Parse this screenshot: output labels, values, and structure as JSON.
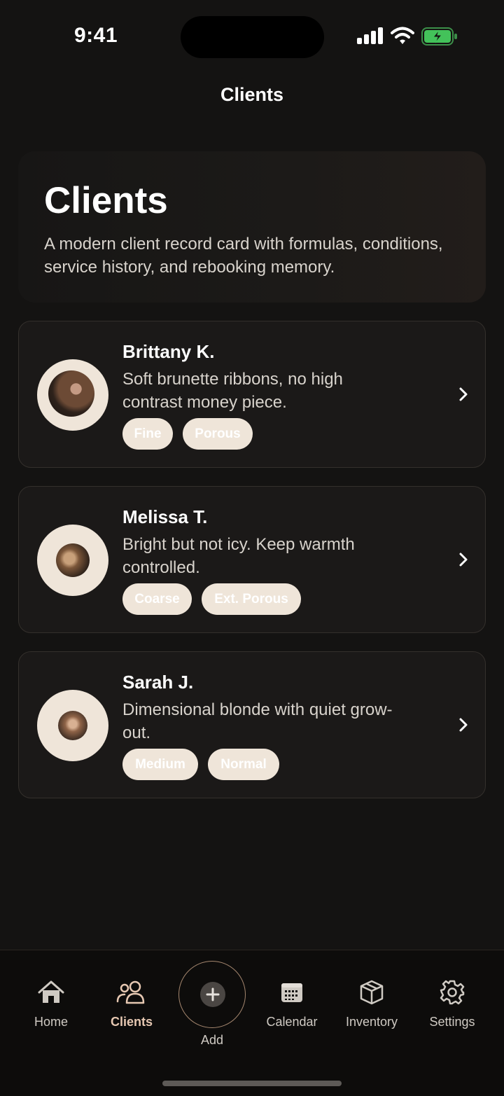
{
  "status_bar": {
    "time": "9:41"
  },
  "nav": {
    "title": "Clients"
  },
  "header": {
    "title": "Clients",
    "subtitle": "A modern client record card with formulas, conditions, service history, and rebooking memory."
  },
  "clients": [
    {
      "name": "Brittany K.",
      "note": "Soft brunette ribbons, no high contrast money piece.",
      "tags": [
        "Fine",
        "Porous"
      ]
    },
    {
      "name": "Melissa T.",
      "note": "Bright but not icy. Keep warmth controlled.",
      "tags": [
        "Coarse",
        "Ext. Porous"
      ]
    },
    {
      "name": "Sarah J.",
      "note": "Dimensional blonde with quiet grow-out.",
      "tags": [
        "Medium",
        "Normal"
      ]
    }
  ],
  "tab_bar": {
    "items": [
      {
        "label": "Home",
        "icon": "home-icon",
        "active": false
      },
      {
        "label": "Clients",
        "icon": "people-icon",
        "active": true
      },
      {
        "label": "Add",
        "icon": "plus-icon",
        "active": false
      },
      {
        "label": "Calendar",
        "icon": "calendar-icon",
        "active": false
      },
      {
        "label": "Inventory",
        "icon": "box-icon",
        "active": false
      },
      {
        "label": "Settings",
        "icon": "gear-icon",
        "active": false
      }
    ]
  },
  "colors": {
    "background": "#141312",
    "card": "#1b1918",
    "accent": "#e6c8b2",
    "tag_bg": "#efe5d9"
  }
}
